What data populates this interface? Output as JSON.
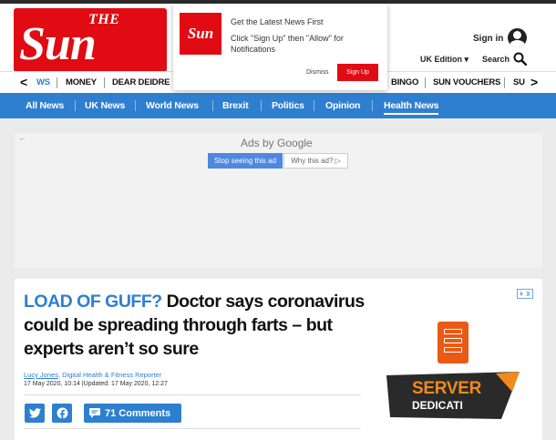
{
  "brand": {
    "the": "THE",
    "sun": "Sun",
    "mini": "Sun",
    "color": "#e00b13"
  },
  "notification": {
    "title": "Get the Latest News First",
    "body": "Click \"Sign Up\" then \"Allow\" for Notifications",
    "dismiss_label": "Dismiss",
    "signup_label": "Sign Up"
  },
  "header": {
    "signin_label": "Sign in",
    "edition_label": "UK Edition ▾",
    "search_label": "Search",
    "avatar_icon": "user-icon",
    "search_icon": "search-icon"
  },
  "top_nav": {
    "prev_arrow": "<",
    "next_arrow": ">",
    "items": [
      {
        "label": "WS"
      },
      {
        "label": "MONEY"
      },
      {
        "label": "DEAR DEIDRE"
      },
      {
        "label": "BINGO"
      },
      {
        "label": "SUN VOUCHERS"
      },
      {
        "label": "SU"
      }
    ]
  },
  "section_nav": {
    "color": "#2f7fd0",
    "items": [
      {
        "label": "All News"
      },
      {
        "label": "UK News"
      },
      {
        "label": "World News"
      },
      {
        "label": "Brexit"
      },
      {
        "label": "Politics"
      },
      {
        "label": "Opinion"
      },
      {
        "label": "Health News",
        "active": true
      }
    ]
  },
  "ad": {
    "back_arrow": "←",
    "ads_by": "Ads by Google",
    "stop_label": "Stop seeing this ad",
    "why_label": "Why this ad? ▷"
  },
  "article": {
    "kicker": "LOAD OF GUFF?",
    "headline": " Doctor says coronavirus could be spreading through farts – but experts aren’t so sure",
    "author": "Lucy Jones",
    "role": ", Digital Health & Fitness Reporter",
    "dates": "17 May 2020, 10:14 |Updated: 17 May 2020, 12:27",
    "comments_label": "71 Comments",
    "share_icons": [
      "twitter-icon",
      "facebook-icon",
      "comment-icon"
    ]
  },
  "side_ad": {
    "line1": "SERVER",
    "line2": "DEDICATI",
    "badge_icon": "ad-choices-icon"
  }
}
